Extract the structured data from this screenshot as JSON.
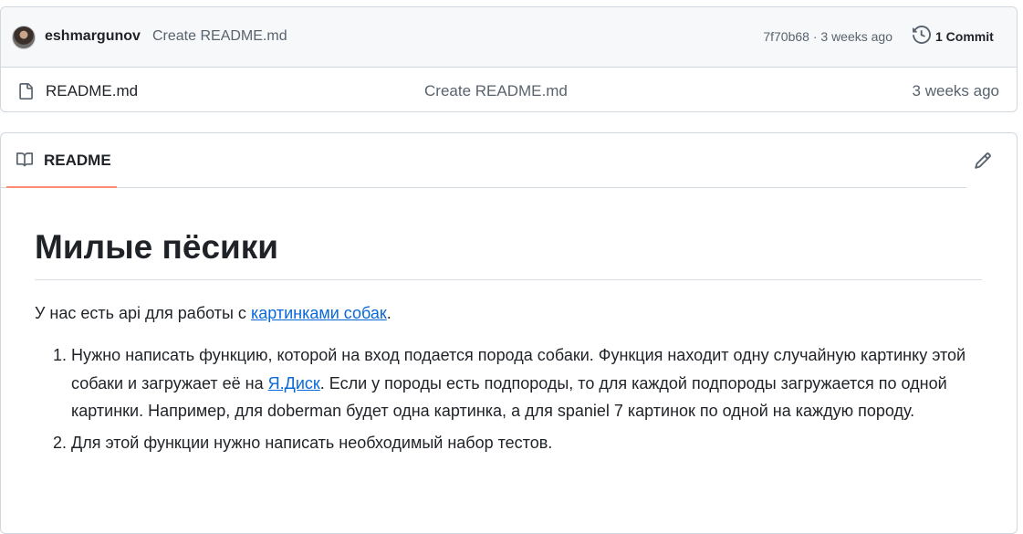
{
  "latest_commit": {
    "author": "eshmargunov",
    "message": "Create README.md",
    "hash_time": "7f70b68 · 3 weeks ago",
    "commits_label": "1 Commit"
  },
  "files": [
    {
      "name": "README.md",
      "message": "Create README.md",
      "age": "3 weeks ago"
    }
  ],
  "readme": {
    "tab_label": "README",
    "title": "Милые пёсики",
    "intro_before": "У нас есть api для работы с ",
    "intro_link": "картинками собак",
    "intro_after": ".",
    "item1_before": "Нужно написать функцию, которой на вход подается порода собаки. Функция находит одну случайную картинку этой собаки и загружает её на ",
    "item1_link": "Я.Диск",
    "item1_after": ". Если у породы есть подпороды, то для каждой подпороды загружается по одной картинки. Например, для doberman будет одна картинка, а для spaniel 7 картинок по одной на каждую породу.",
    "item2": "Для этой функции нужно написать необходимый набор тестов."
  },
  "icons": {
    "file": "file-icon",
    "history": "clock-icon",
    "readme": "book-icon",
    "edit": "pencil-icon"
  },
  "colors": {
    "link": "#0969da",
    "tab_underline": "#fd8c73",
    "muted_text": "#59636e",
    "border": "#d0d7de"
  }
}
